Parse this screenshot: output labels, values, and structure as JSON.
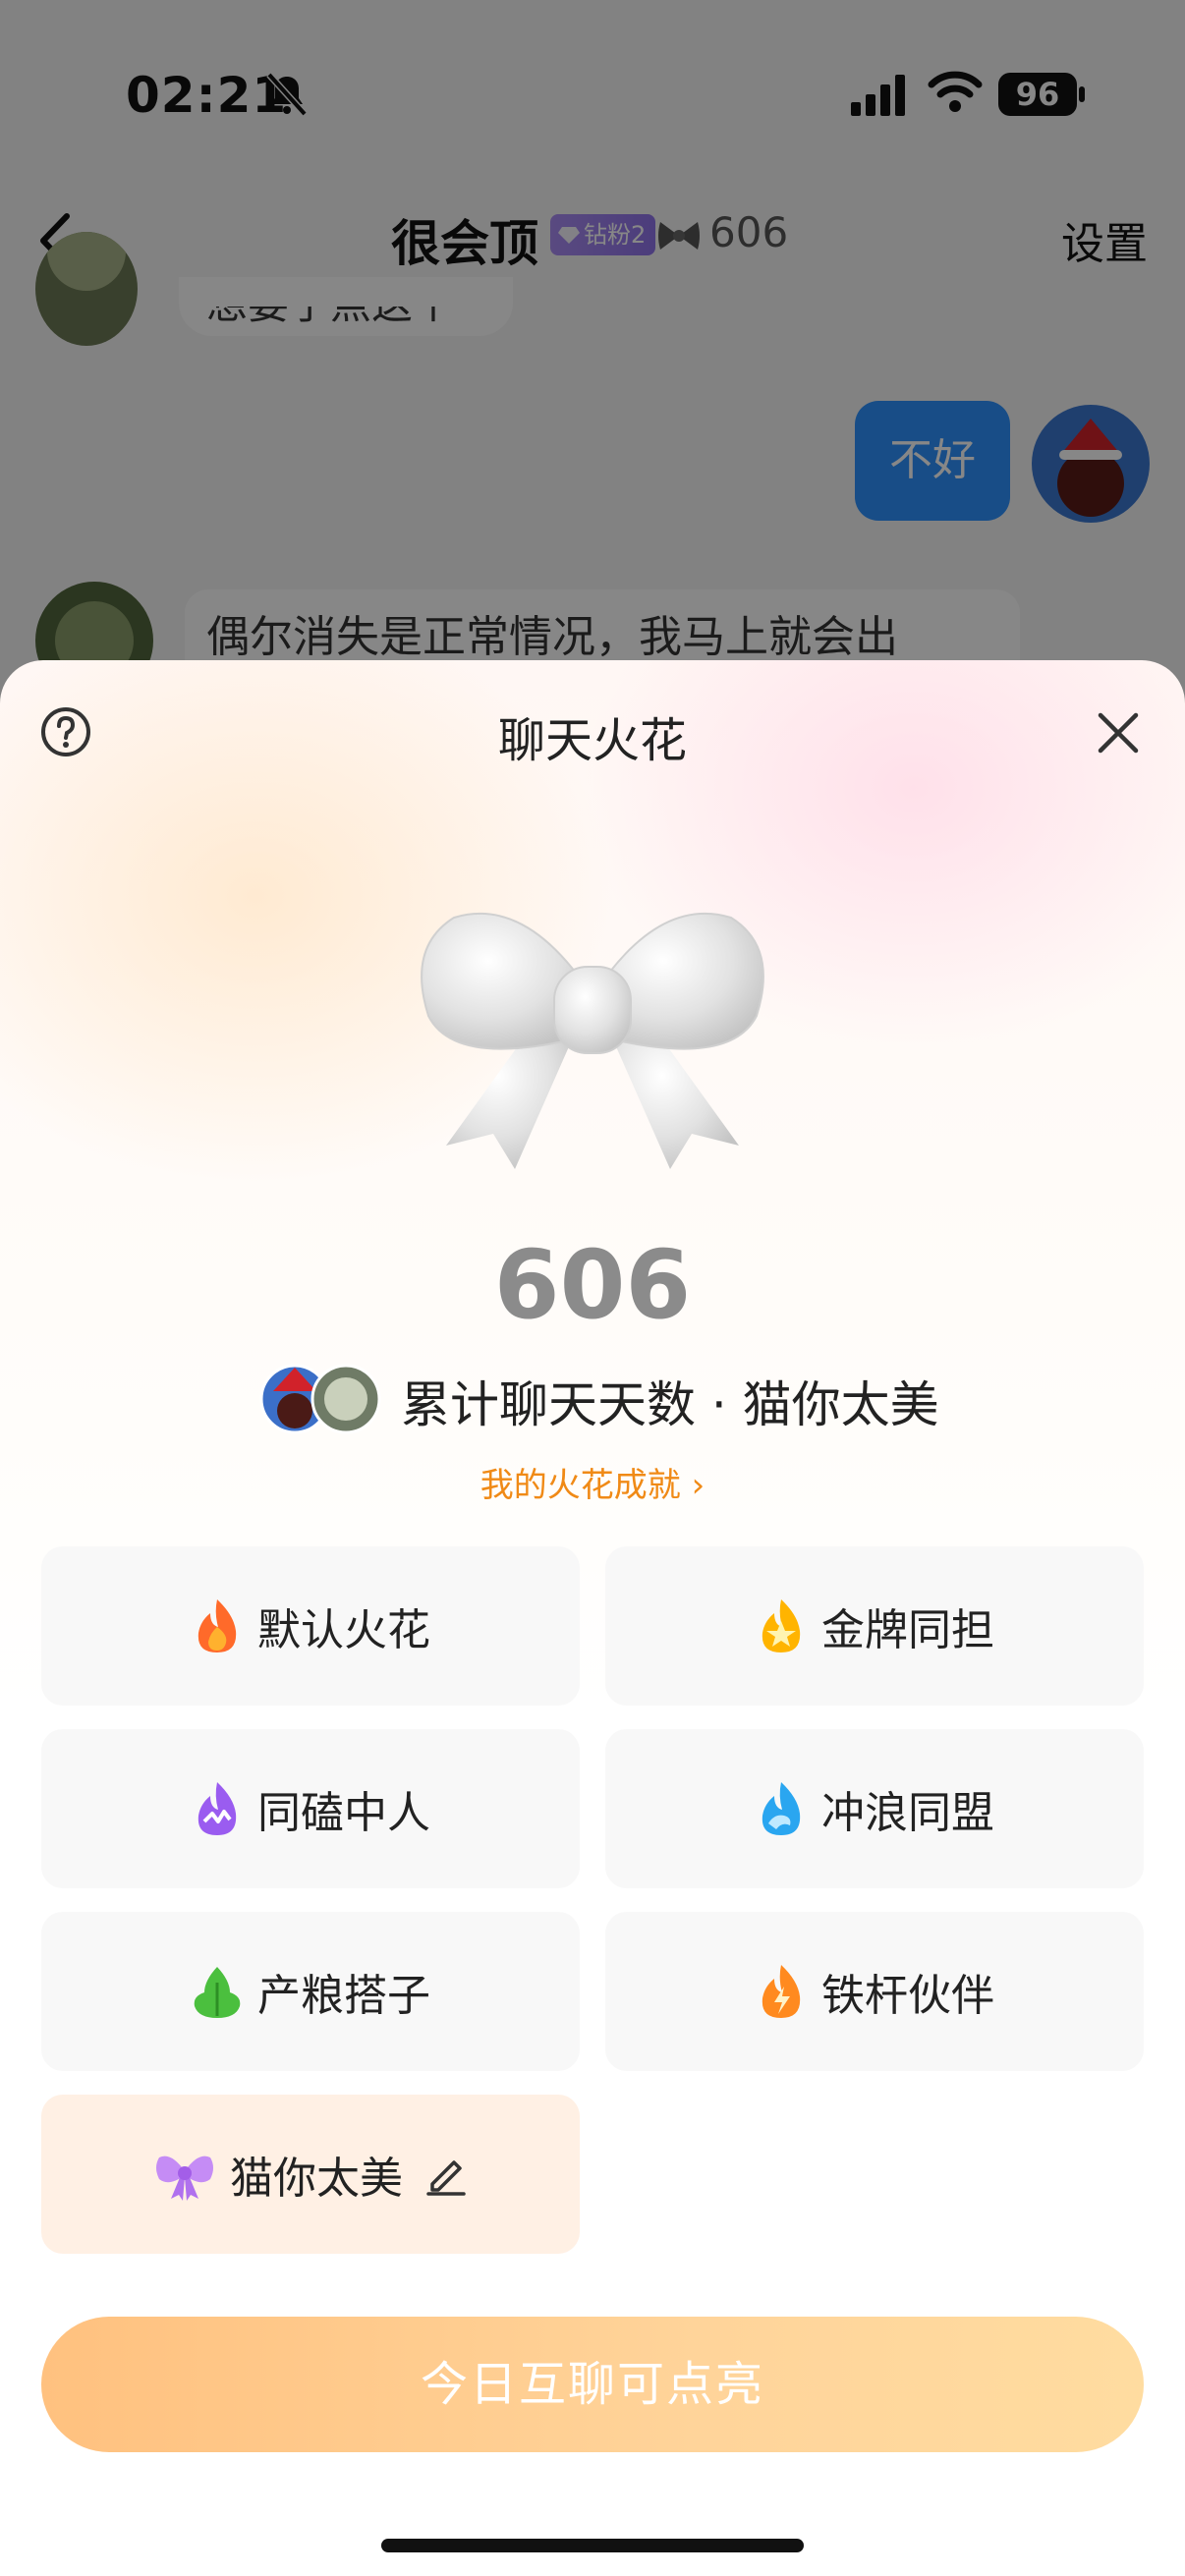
{
  "status_bar": {
    "time": "02:21",
    "battery": "96"
  },
  "nav": {
    "title": "很会顶",
    "badge": "钻粉2",
    "streak": "606",
    "settings": "设置"
  },
  "chat": {
    "top_message": "想要了点这个",
    "outgoing_message": "不好",
    "incoming_message": "偶尔消失是正常情况，我马上就会出"
  },
  "sheet": {
    "title": "聊天火花",
    "streak_count": "606",
    "cumulative_label": "累计聊天天数 · 猫你太美",
    "achievement_link": "我的火花成就 ›",
    "cards": [
      {
        "label": "默认火花",
        "icon": "flame-orange-icon"
      },
      {
        "label": "金牌同担",
        "icon": "flame-gold-star-icon"
      },
      {
        "label": "同磕中人",
        "icon": "flame-purple-icon"
      },
      {
        "label": "冲浪同盟",
        "icon": "flame-blue-wave-icon"
      },
      {
        "label": "产粮搭子",
        "icon": "leaf-green-icon"
      },
      {
        "label": "铁杆伙伴",
        "icon": "flame-lightning-icon"
      },
      {
        "label": "猫你太美",
        "icon": "purple-bow-icon"
      }
    ],
    "button": "今日互聊可点亮"
  },
  "colors": {
    "accent_orange": "#f08a16",
    "button_gradient_start": "#ffc17f",
    "button_gradient_end": "#ffdca0",
    "chat_blue": "#2f92ff",
    "selected_card": "#fff0e4"
  }
}
